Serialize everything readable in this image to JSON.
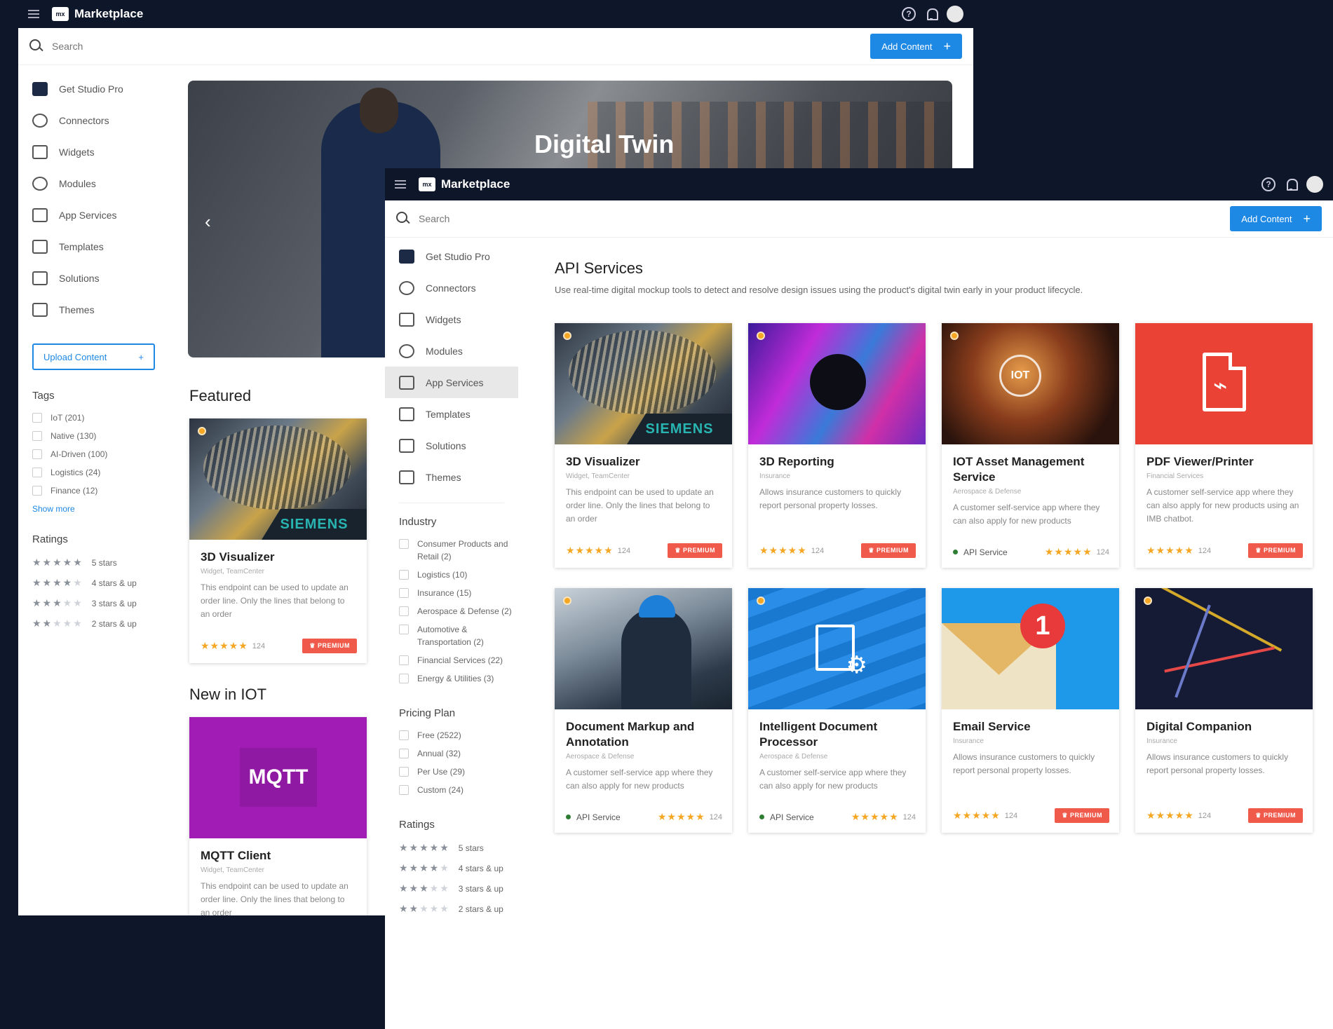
{
  "app": {
    "name": "Marketplace",
    "logo": "mx"
  },
  "search": {
    "placeholder": "Search"
  },
  "add_content": {
    "label": "Add Content",
    "plus": "+"
  },
  "nav": [
    {
      "label": "Get Studio Pro",
      "icon": "mx-logo-icon"
    },
    {
      "label": "Connectors",
      "icon": "connectors-icon"
    },
    {
      "label": "Widgets",
      "icon": "widgets-icon"
    },
    {
      "label": "Modules",
      "icon": "modules-icon"
    },
    {
      "label": "App Services",
      "icon": "app-services-icon"
    },
    {
      "label": "Templates",
      "icon": "templates-icon"
    },
    {
      "label": "Solutions",
      "icon": "solutions-icon"
    },
    {
      "label": "Themes",
      "icon": "themes-icon"
    }
  ],
  "back": {
    "upload": {
      "label": "Upload Content",
      "plus": "+"
    },
    "tags_title": "Tags",
    "tags": [
      "IoT (201)",
      "Native (130)",
      "AI-Driven (100)",
      "Logistics (24)",
      "Finance (12)"
    ],
    "show_more": "Show more",
    "ratings_title": "Ratings",
    "ratings": [
      {
        "stars": "★★★★★",
        "label": "5 stars"
      },
      {
        "stars": "★★★★★",
        "label": "4 stars & up"
      },
      {
        "stars": "★★★★★",
        "label": "3 stars & up"
      },
      {
        "stars": "★★★★★",
        "label": "2 stars & up"
      }
    ],
    "hero_title": "Digital Twin",
    "hero_prev": "‹",
    "featured_title": "Featured",
    "featured_card": {
      "title": "3D Visualizer",
      "cat": "Widget, TeamCenter",
      "desc": "This endpoint can be used to update an order line. Only the lines that belong to an order",
      "stars": "★★★★★",
      "count": "124",
      "premium": "♛ PREMIUM",
      "brand": "SIEMENS"
    },
    "new_title": "New in IOT",
    "new_card": {
      "title": "MQTT Client",
      "cat": "Widget, TeamCenter",
      "desc": "This endpoint can be used to update an order line. Only the lines that belong to an order",
      "logo": "MQTT"
    }
  },
  "front": {
    "industry_title": "Industry",
    "industry": [
      "Consumer Products and Retail (2)",
      "Logistics (10)",
      "Insurance (15)",
      "Aerospace & Defense (2)",
      "Automotive & Transportation (2)",
      "Financial Services (22)",
      "Energy & Utilities (3)"
    ],
    "pricing_title": "Pricing Plan",
    "pricing": [
      "Free (2522)",
      "Annual (32)",
      "Per Use (29)",
      "Custom (24)"
    ],
    "ratings_title": "Ratings",
    "ratings": [
      {
        "stars": "★★★★★",
        "label": "5 stars"
      },
      {
        "stars": "★★★★★",
        "label": "4 stars & up"
      },
      {
        "stars": "★★★★★",
        "label": "3 stars & up"
      },
      {
        "stars": "★★★★★",
        "label": "2 stars & up"
      }
    ],
    "section_title": "API Services",
    "section_desc": "Use real-time digital mockup tools to detect and resolve design issues using the product's digital twin early in your product lifecycle.",
    "cards": [
      {
        "title": "3D Visualizer",
        "cat": "Widget, TeamCenter",
        "desc": "This endpoint can be used to update an order line. Only the lines that belong to an order",
        "stars": "★★★★★",
        "count": "124",
        "premium": "♛ PREMIUM",
        "brand": "SIEMENS"
      },
      {
        "title": "3D Reporting",
        "cat": "Insurance",
        "desc": "Allows insurance customers to quickly report personal property losses.",
        "stars": "★★★★★",
        "count": "124",
        "premium": "♛ PREMIUM"
      },
      {
        "title": "IOT Asset Management Service",
        "cat": "Aerospace & Defense",
        "desc": "A customer self-service app where they can also apply for new products",
        "stars": "★★★★★",
        "count": "124",
        "api": "API Service",
        "badge": "IOT"
      },
      {
        "title": "PDF Viewer/Printer",
        "cat": "Financial Services",
        "desc": "A customer self-service app where they can also apply for new products using an IMB chatbot.",
        "stars": "★★★★★",
        "count": "124",
        "premium": "♛ PREMIUM"
      },
      {
        "title": "Document Markup and Annotation",
        "cat": "Aerospace & Defense",
        "desc": "A customer self-service app where they can also apply for new products",
        "stars": "★★★★★",
        "count": "124",
        "api": "API Service"
      },
      {
        "title": "Intelligent Document Processor",
        "cat": "Aerospace & Defense",
        "desc": "A customer self-service app where they can also apply for new products",
        "stars": "★★★★★",
        "count": "124",
        "api": "API Service"
      },
      {
        "title": "Email Service",
        "cat": "Insurance",
        "desc": "Allows insurance customers to quickly report personal property losses.",
        "stars": "★★★★★",
        "count": "124",
        "premium": "♛ PREMIUM",
        "badge": "1"
      },
      {
        "title": "Digital Companion",
        "cat": "Insurance",
        "desc": "Allows insurance customers to quickly report personal property losses.",
        "stars": "★★★★★",
        "count": "124",
        "premium": "♛ PREMIUM"
      }
    ]
  },
  "colors": {
    "topbar": "#0e1629",
    "accent": "#1e88e5",
    "premium": "#f05a4a",
    "stars": "#f5a623"
  }
}
